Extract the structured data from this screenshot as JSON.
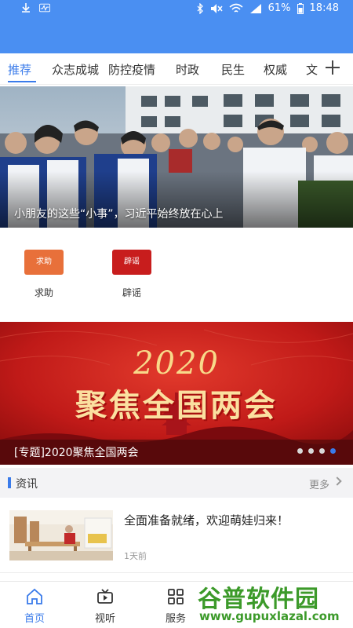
{
  "status_bar": {
    "battery": "61%",
    "time": "18:48"
  },
  "tabs": [
    {
      "label": "推荐",
      "active": true
    },
    {
      "label": "众志成城"
    },
    {
      "label": "防控疫情"
    },
    {
      "label": "时政"
    },
    {
      "label": "民生"
    },
    {
      "label": "权威"
    },
    {
      "label": "文"
    }
  ],
  "hero": {
    "caption": "小朋友的这些“小事”，习近平始终放在心上"
  },
  "quick_entries": [
    {
      "icon_text": "求助",
      "label": "求助",
      "color": "#e8703a"
    },
    {
      "icon_text": "辟谣",
      "label": "辟谣",
      "color": "#c81d1d"
    }
  ],
  "banner": {
    "year": "2020",
    "headline": "聚焦全国两会",
    "caption": "[专题]2020聚焦全国两会",
    "slides": 4,
    "active_slide": 4
  },
  "section": {
    "title": "资讯",
    "more": "更多"
  },
  "news": [
    {
      "title": "全面准备就绪，欢迎萌娃归来！",
      "time": "1天前"
    }
  ],
  "bottom_nav": [
    {
      "label": "首页",
      "icon": "home-icon",
      "active": true
    },
    {
      "label": "视听",
      "icon": "video-icon"
    },
    {
      "label": "服务",
      "icon": "grid-icon"
    }
  ],
  "watermark": {
    "brand": "谷普软件园",
    "url": "www.gupuxlazal.com"
  },
  "colors": {
    "accent": "#3a7bea",
    "header": "#4a8ff2",
    "banner_red": "#c81d1d"
  }
}
